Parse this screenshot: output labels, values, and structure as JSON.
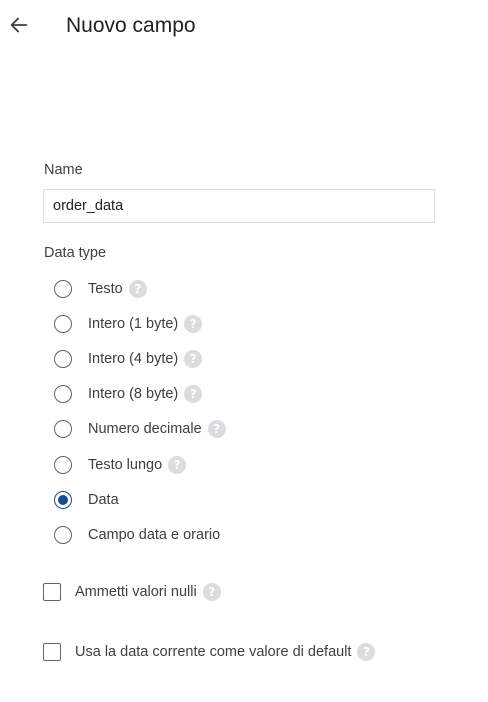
{
  "header": {
    "back_icon": "arrow-left-icon",
    "title": "Nuovo campo"
  },
  "name_field": {
    "label": "Name",
    "value": "order_data"
  },
  "data_type": {
    "label": "Data type",
    "selected": "Data",
    "options": [
      {
        "label": "Testo",
        "help": true,
        "checked": false
      },
      {
        "label": "Intero (1 byte)",
        "help": true,
        "checked": false
      },
      {
        "label": "Intero (4 byte)",
        "help": true,
        "checked": false
      },
      {
        "label": "Intero (8 byte)",
        "help": true,
        "checked": false
      },
      {
        "label": "Numero decimale",
        "help": true,
        "checked": false
      },
      {
        "label": "Testo lungo",
        "help": true,
        "checked": false
      },
      {
        "label": "Data",
        "help": false,
        "checked": true
      },
      {
        "label": "Campo data e orario",
        "help": false,
        "checked": false
      }
    ]
  },
  "checkboxes": {
    "allow_null": {
      "label": "Ammetti valori nulli",
      "checked": false
    },
    "default_current_date": {
      "label": "Usa la data corrente come valore di default",
      "checked": false
    }
  },
  "help_glyph": "?",
  "colors": {
    "accent": "#1a4c8b",
    "border": "#dadce0",
    "help_icon_bg": "#dadce0",
    "text": "#202124"
  }
}
